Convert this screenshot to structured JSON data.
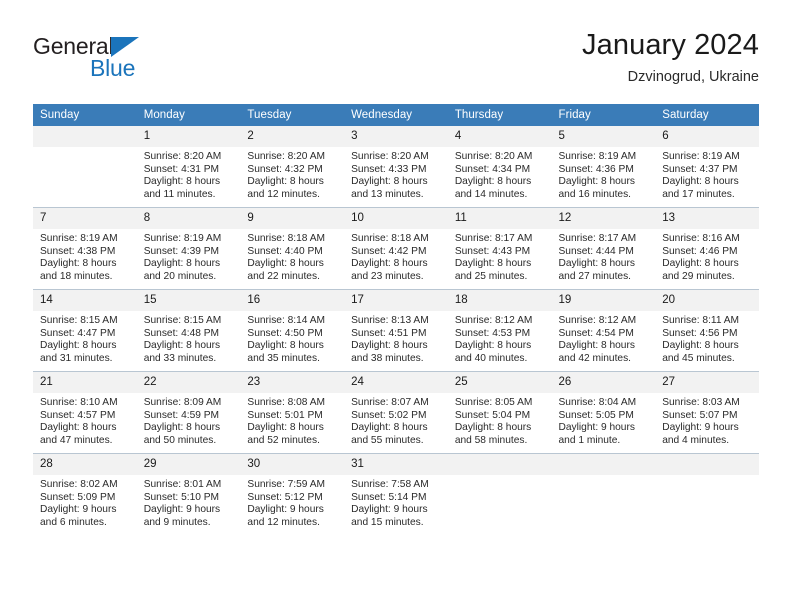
{
  "brand": {
    "name_part1": "General",
    "name_part2": "Blue",
    "triangle_color": "#1b74bb",
    "text_color": "#231f20"
  },
  "header": {
    "title": "January 2024",
    "subtitle": "Dzvinogrud, Ukraine"
  },
  "calendar": {
    "header_bg": "#3a7cb8",
    "daynum_bg": "#f2f2f2",
    "weekdays": [
      "Sunday",
      "Monday",
      "Tuesday",
      "Wednesday",
      "Thursday",
      "Friday",
      "Saturday"
    ],
    "weeks": [
      [
        {
          "day": "",
          "sunrise": "",
          "sunset": "",
          "daylight1": "",
          "daylight2": ""
        },
        {
          "day": "1",
          "sunrise": "Sunrise: 8:20 AM",
          "sunset": "Sunset: 4:31 PM",
          "daylight1": "Daylight: 8 hours",
          "daylight2": "and 11 minutes."
        },
        {
          "day": "2",
          "sunrise": "Sunrise: 8:20 AM",
          "sunset": "Sunset: 4:32 PM",
          "daylight1": "Daylight: 8 hours",
          "daylight2": "and 12 minutes."
        },
        {
          "day": "3",
          "sunrise": "Sunrise: 8:20 AM",
          "sunset": "Sunset: 4:33 PM",
          "daylight1": "Daylight: 8 hours",
          "daylight2": "and 13 minutes."
        },
        {
          "day": "4",
          "sunrise": "Sunrise: 8:20 AM",
          "sunset": "Sunset: 4:34 PM",
          "daylight1": "Daylight: 8 hours",
          "daylight2": "and 14 minutes."
        },
        {
          "day": "5",
          "sunrise": "Sunrise: 8:19 AM",
          "sunset": "Sunset: 4:36 PM",
          "daylight1": "Daylight: 8 hours",
          "daylight2": "and 16 minutes."
        },
        {
          "day": "6",
          "sunrise": "Sunrise: 8:19 AM",
          "sunset": "Sunset: 4:37 PM",
          "daylight1": "Daylight: 8 hours",
          "daylight2": "and 17 minutes."
        }
      ],
      [
        {
          "day": "7",
          "sunrise": "Sunrise: 8:19 AM",
          "sunset": "Sunset: 4:38 PM",
          "daylight1": "Daylight: 8 hours",
          "daylight2": "and 18 minutes."
        },
        {
          "day": "8",
          "sunrise": "Sunrise: 8:19 AM",
          "sunset": "Sunset: 4:39 PM",
          "daylight1": "Daylight: 8 hours",
          "daylight2": "and 20 minutes."
        },
        {
          "day": "9",
          "sunrise": "Sunrise: 8:18 AM",
          "sunset": "Sunset: 4:40 PM",
          "daylight1": "Daylight: 8 hours",
          "daylight2": "and 22 minutes."
        },
        {
          "day": "10",
          "sunrise": "Sunrise: 8:18 AM",
          "sunset": "Sunset: 4:42 PM",
          "daylight1": "Daylight: 8 hours",
          "daylight2": "and 23 minutes."
        },
        {
          "day": "11",
          "sunrise": "Sunrise: 8:17 AM",
          "sunset": "Sunset: 4:43 PM",
          "daylight1": "Daylight: 8 hours",
          "daylight2": "and 25 minutes."
        },
        {
          "day": "12",
          "sunrise": "Sunrise: 8:17 AM",
          "sunset": "Sunset: 4:44 PM",
          "daylight1": "Daylight: 8 hours",
          "daylight2": "and 27 minutes."
        },
        {
          "day": "13",
          "sunrise": "Sunrise: 8:16 AM",
          "sunset": "Sunset: 4:46 PM",
          "daylight1": "Daylight: 8 hours",
          "daylight2": "and 29 minutes."
        }
      ],
      [
        {
          "day": "14",
          "sunrise": "Sunrise: 8:15 AM",
          "sunset": "Sunset: 4:47 PM",
          "daylight1": "Daylight: 8 hours",
          "daylight2": "and 31 minutes."
        },
        {
          "day": "15",
          "sunrise": "Sunrise: 8:15 AM",
          "sunset": "Sunset: 4:48 PM",
          "daylight1": "Daylight: 8 hours",
          "daylight2": "and 33 minutes."
        },
        {
          "day": "16",
          "sunrise": "Sunrise: 8:14 AM",
          "sunset": "Sunset: 4:50 PM",
          "daylight1": "Daylight: 8 hours",
          "daylight2": "and 35 minutes."
        },
        {
          "day": "17",
          "sunrise": "Sunrise: 8:13 AM",
          "sunset": "Sunset: 4:51 PM",
          "daylight1": "Daylight: 8 hours",
          "daylight2": "and 38 minutes."
        },
        {
          "day": "18",
          "sunrise": "Sunrise: 8:12 AM",
          "sunset": "Sunset: 4:53 PM",
          "daylight1": "Daylight: 8 hours",
          "daylight2": "and 40 minutes."
        },
        {
          "day": "19",
          "sunrise": "Sunrise: 8:12 AM",
          "sunset": "Sunset: 4:54 PM",
          "daylight1": "Daylight: 8 hours",
          "daylight2": "and 42 minutes."
        },
        {
          "day": "20",
          "sunrise": "Sunrise: 8:11 AM",
          "sunset": "Sunset: 4:56 PM",
          "daylight1": "Daylight: 8 hours",
          "daylight2": "and 45 minutes."
        }
      ],
      [
        {
          "day": "21",
          "sunrise": "Sunrise: 8:10 AM",
          "sunset": "Sunset: 4:57 PM",
          "daylight1": "Daylight: 8 hours",
          "daylight2": "and 47 minutes."
        },
        {
          "day": "22",
          "sunrise": "Sunrise: 8:09 AM",
          "sunset": "Sunset: 4:59 PM",
          "daylight1": "Daylight: 8 hours",
          "daylight2": "and 50 minutes."
        },
        {
          "day": "23",
          "sunrise": "Sunrise: 8:08 AM",
          "sunset": "Sunset: 5:01 PM",
          "daylight1": "Daylight: 8 hours",
          "daylight2": "and 52 minutes."
        },
        {
          "day": "24",
          "sunrise": "Sunrise: 8:07 AM",
          "sunset": "Sunset: 5:02 PM",
          "daylight1": "Daylight: 8 hours",
          "daylight2": "and 55 minutes."
        },
        {
          "day": "25",
          "sunrise": "Sunrise: 8:05 AM",
          "sunset": "Sunset: 5:04 PM",
          "daylight1": "Daylight: 8 hours",
          "daylight2": "and 58 minutes."
        },
        {
          "day": "26",
          "sunrise": "Sunrise: 8:04 AM",
          "sunset": "Sunset: 5:05 PM",
          "daylight1": "Daylight: 9 hours",
          "daylight2": "and 1 minute."
        },
        {
          "day": "27",
          "sunrise": "Sunrise: 8:03 AM",
          "sunset": "Sunset: 5:07 PM",
          "daylight1": "Daylight: 9 hours",
          "daylight2": "and 4 minutes."
        }
      ],
      [
        {
          "day": "28",
          "sunrise": "Sunrise: 8:02 AM",
          "sunset": "Sunset: 5:09 PM",
          "daylight1": "Daylight: 9 hours",
          "daylight2": "and 6 minutes."
        },
        {
          "day": "29",
          "sunrise": "Sunrise: 8:01 AM",
          "sunset": "Sunset: 5:10 PM",
          "daylight1": "Daylight: 9 hours",
          "daylight2": "and 9 minutes."
        },
        {
          "day": "30",
          "sunrise": "Sunrise: 7:59 AM",
          "sunset": "Sunset: 5:12 PM",
          "daylight1": "Daylight: 9 hours",
          "daylight2": "and 12 minutes."
        },
        {
          "day": "31",
          "sunrise": "Sunrise: 7:58 AM",
          "sunset": "Sunset: 5:14 PM",
          "daylight1": "Daylight: 9 hours",
          "daylight2": "and 15 minutes."
        },
        {
          "day": "",
          "sunrise": "",
          "sunset": "",
          "daylight1": "",
          "daylight2": ""
        },
        {
          "day": "",
          "sunrise": "",
          "sunset": "",
          "daylight1": "",
          "daylight2": ""
        },
        {
          "day": "",
          "sunrise": "",
          "sunset": "",
          "daylight1": "",
          "daylight2": ""
        }
      ]
    ]
  }
}
